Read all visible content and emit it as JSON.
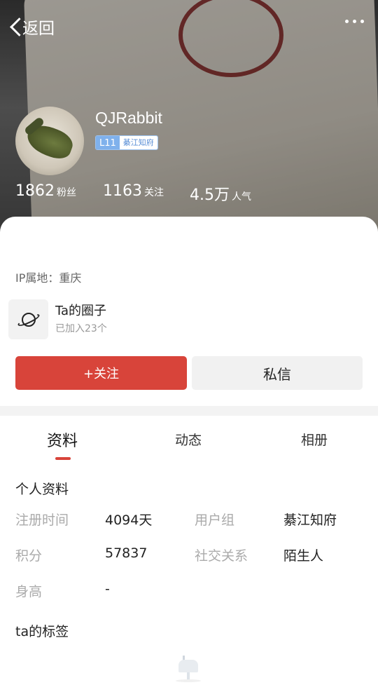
{
  "header": {
    "back_label": "返回",
    "username": "QJRabbit",
    "level": "L11",
    "group_badge": "綦江知府",
    "stats": [
      {
        "value": "1862",
        "label": "粉丝"
      },
      {
        "value": "1163",
        "label": "关注"
      },
      {
        "value": "4.5万",
        "label": "人气"
      }
    ]
  },
  "profile": {
    "ip_location": "IP属地：重庆",
    "circle": {
      "title": "Ta的圈子",
      "subtitle": "已加入23个"
    },
    "follow_label": "+关注",
    "message_label": "私信"
  },
  "tabs": [
    {
      "label": "资料",
      "active": true
    },
    {
      "label": "动态",
      "active": false
    },
    {
      "label": "相册",
      "active": false
    }
  ],
  "info": {
    "section_title": "个人资料",
    "rows": [
      {
        "label": "注册时间",
        "value": "4094天"
      },
      {
        "label": "用户组",
        "value": "綦江知府"
      },
      {
        "label": "积分",
        "value": "57837"
      },
      {
        "label": "社交关系",
        "value": "陌生人"
      },
      {
        "label": "身高",
        "value": "-"
      }
    ],
    "tags_title": "ta的标签"
  },
  "colors": {
    "accent": "#d8443a",
    "level_badge": "#7fb1ec"
  }
}
